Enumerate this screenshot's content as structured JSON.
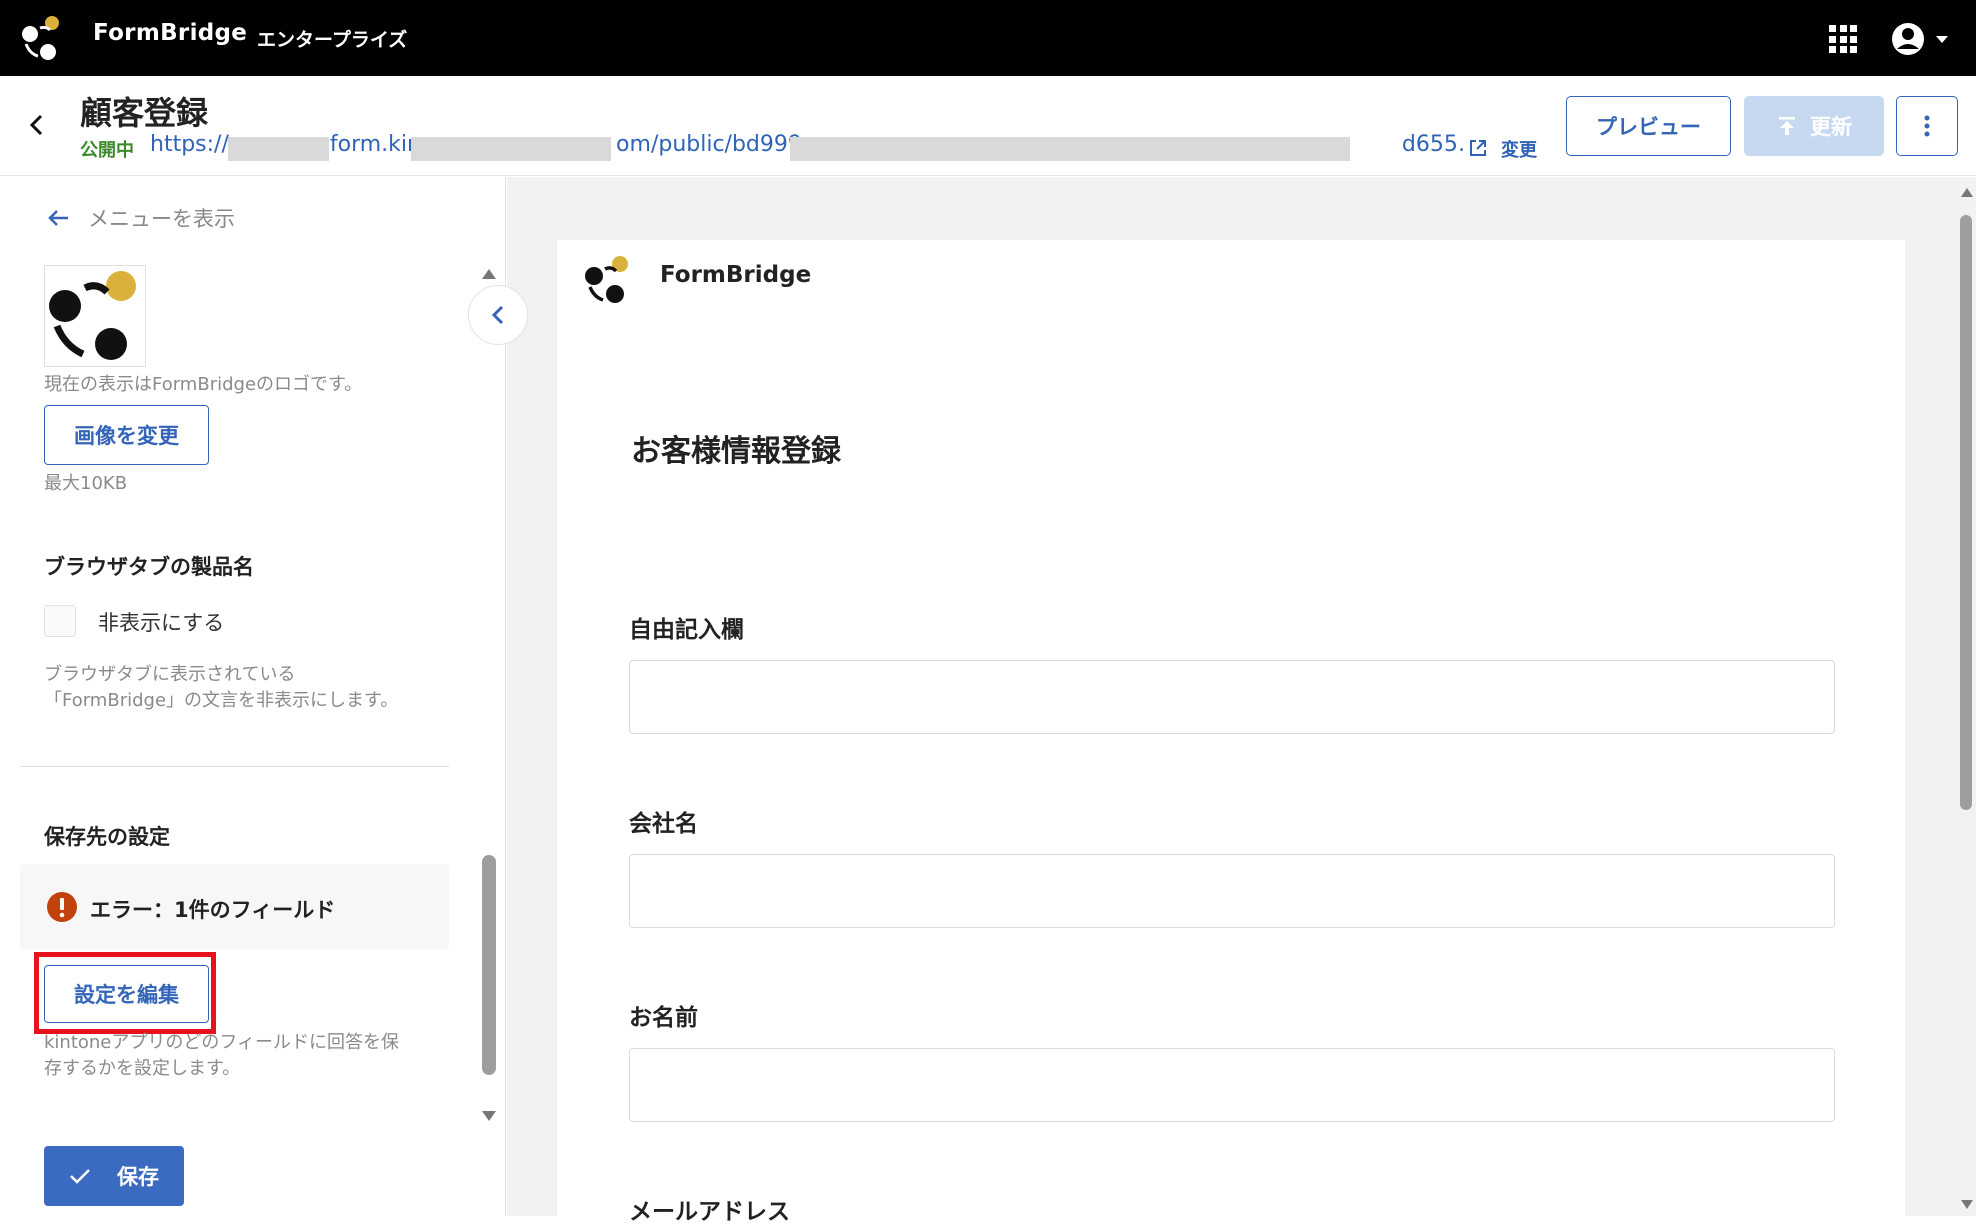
{
  "topbar": {
    "brand": "FormBridge",
    "edition": "エンタープライズ"
  },
  "header": {
    "title": "顧客登録",
    "status": "公開中",
    "url_parts": [
      "https://",
      "form.kir",
      "om/public/bd999",
      "d655…"
    ],
    "change_label": "変更",
    "preview_label": "プレビュー",
    "update_label": "更新"
  },
  "left": {
    "menu_label": "メニューを表示",
    "logo_hint": "現在の表示はFormBridgeのロゴです。",
    "change_image_label": "画像を変更",
    "max_size_hint": "最大10KB",
    "browser_tab_title": "ブラウザタブの製品名",
    "hide_label": "非表示にする",
    "hide_hint_line1": "ブラウザタブに表示されている",
    "hide_hint_line2": "「FormBridge」の文言を非表示にします。",
    "storage_title": "保存先の設定",
    "error_text": "エラー：1件のフィールド",
    "edit_settings_label": "設定を編集",
    "storage_hint_line1": "kintoneアプリのどのフィールドに回答を保",
    "storage_hint_line2": "存するかを設定します。",
    "save_label": "保存"
  },
  "form": {
    "brand": "FormBridge",
    "title": "お客様情報登録",
    "fields": [
      {
        "label": "自由記入欄"
      },
      {
        "label": "会社名"
      },
      {
        "label": "お名前"
      },
      {
        "label": "メールアドレス"
      }
    ]
  },
  "colors": {
    "accent": "#3465b8",
    "highlight": "#e8121e",
    "error": "#c2410c",
    "logo_gold": "#d9b13b"
  }
}
